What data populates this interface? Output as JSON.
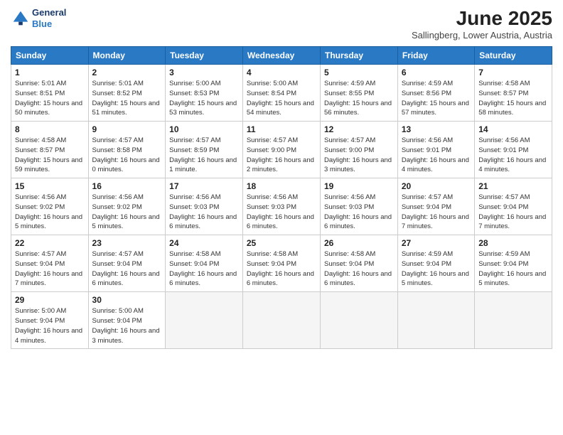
{
  "header": {
    "logo_line1": "General",
    "logo_line2": "Blue",
    "month": "June 2025",
    "location": "Sallingberg, Lower Austria, Austria"
  },
  "weekdays": [
    "Sunday",
    "Monday",
    "Tuesday",
    "Wednesday",
    "Thursday",
    "Friday",
    "Saturday"
  ],
  "days": [
    {
      "num": "",
      "info": ""
    },
    {
      "num": "",
      "info": ""
    },
    {
      "num": "",
      "info": ""
    },
    {
      "num": "",
      "info": ""
    },
    {
      "num": "",
      "info": ""
    },
    {
      "num": "",
      "info": ""
    },
    {
      "num": "",
      "info": ""
    },
    {
      "num": "1",
      "sunrise": "5:01 AM",
      "sunset": "8:51 PM",
      "daylight": "15 hours and 50 minutes."
    },
    {
      "num": "2",
      "sunrise": "5:01 AM",
      "sunset": "8:52 PM",
      "daylight": "15 hours and 51 minutes."
    },
    {
      "num": "3",
      "sunrise": "5:00 AM",
      "sunset": "8:53 PM",
      "daylight": "15 hours and 53 minutes."
    },
    {
      "num": "4",
      "sunrise": "5:00 AM",
      "sunset": "8:54 PM",
      "daylight": "15 hours and 54 minutes."
    },
    {
      "num": "5",
      "sunrise": "4:59 AM",
      "sunset": "8:55 PM",
      "daylight": "15 hours and 56 minutes."
    },
    {
      "num": "6",
      "sunrise": "4:59 AM",
      "sunset": "8:56 PM",
      "daylight": "15 hours and 57 minutes."
    },
    {
      "num": "7",
      "sunrise": "4:58 AM",
      "sunset": "8:57 PM",
      "daylight": "15 hours and 58 minutes."
    },
    {
      "num": "8",
      "sunrise": "4:58 AM",
      "sunset": "8:57 PM",
      "daylight": "15 hours and 59 minutes."
    },
    {
      "num": "9",
      "sunrise": "4:57 AM",
      "sunset": "8:58 PM",
      "daylight": "16 hours and 0 minutes."
    },
    {
      "num": "10",
      "sunrise": "4:57 AM",
      "sunset": "8:59 PM",
      "daylight": "16 hours and 1 minute."
    },
    {
      "num": "11",
      "sunrise": "4:57 AM",
      "sunset": "9:00 PM",
      "daylight": "16 hours and 2 minutes."
    },
    {
      "num": "12",
      "sunrise": "4:57 AM",
      "sunset": "9:00 PM",
      "daylight": "16 hours and 3 minutes."
    },
    {
      "num": "13",
      "sunrise": "4:56 AM",
      "sunset": "9:01 PM",
      "daylight": "16 hours and 4 minutes."
    },
    {
      "num": "14",
      "sunrise": "4:56 AM",
      "sunset": "9:01 PM",
      "daylight": "16 hours and 4 minutes."
    },
    {
      "num": "15",
      "sunrise": "4:56 AM",
      "sunset": "9:02 PM",
      "daylight": "16 hours and 5 minutes."
    },
    {
      "num": "16",
      "sunrise": "4:56 AM",
      "sunset": "9:02 PM",
      "daylight": "16 hours and 5 minutes."
    },
    {
      "num": "17",
      "sunrise": "4:56 AM",
      "sunset": "9:03 PM",
      "daylight": "16 hours and 6 minutes."
    },
    {
      "num": "18",
      "sunrise": "4:56 AM",
      "sunset": "9:03 PM",
      "daylight": "16 hours and 6 minutes."
    },
    {
      "num": "19",
      "sunrise": "4:56 AM",
      "sunset": "9:03 PM",
      "daylight": "16 hours and 6 minutes."
    },
    {
      "num": "20",
      "sunrise": "4:57 AM",
      "sunset": "9:04 PM",
      "daylight": "16 hours and 7 minutes."
    },
    {
      "num": "21",
      "sunrise": "4:57 AM",
      "sunset": "9:04 PM",
      "daylight": "16 hours and 7 minutes."
    },
    {
      "num": "22",
      "sunrise": "4:57 AM",
      "sunset": "9:04 PM",
      "daylight": "16 hours and 7 minutes."
    },
    {
      "num": "23",
      "sunrise": "4:57 AM",
      "sunset": "9:04 PM",
      "daylight": "16 hours and 6 minutes."
    },
    {
      "num": "24",
      "sunrise": "4:58 AM",
      "sunset": "9:04 PM",
      "daylight": "16 hours and 6 minutes."
    },
    {
      "num": "25",
      "sunrise": "4:58 AM",
      "sunset": "9:04 PM",
      "daylight": "16 hours and 6 minutes."
    },
    {
      "num": "26",
      "sunrise": "4:58 AM",
      "sunset": "9:04 PM",
      "daylight": "16 hours and 6 minutes."
    },
    {
      "num": "27",
      "sunrise": "4:59 AM",
      "sunset": "9:04 PM",
      "daylight": "16 hours and 5 minutes."
    },
    {
      "num": "28",
      "sunrise": "4:59 AM",
      "sunset": "9:04 PM",
      "daylight": "16 hours and 5 minutes."
    },
    {
      "num": "29",
      "sunrise": "5:00 AM",
      "sunset": "9:04 PM",
      "daylight": "16 hours and 4 minutes."
    },
    {
      "num": "30",
      "sunrise": "5:00 AM",
      "sunset": "9:04 PM",
      "daylight": "16 hours and 3 minutes."
    },
    {
      "num": "",
      "info": ""
    },
    {
      "num": "",
      "info": ""
    },
    {
      "num": "",
      "info": ""
    },
    {
      "num": "",
      "info": ""
    },
    {
      "num": "",
      "info": ""
    }
  ]
}
